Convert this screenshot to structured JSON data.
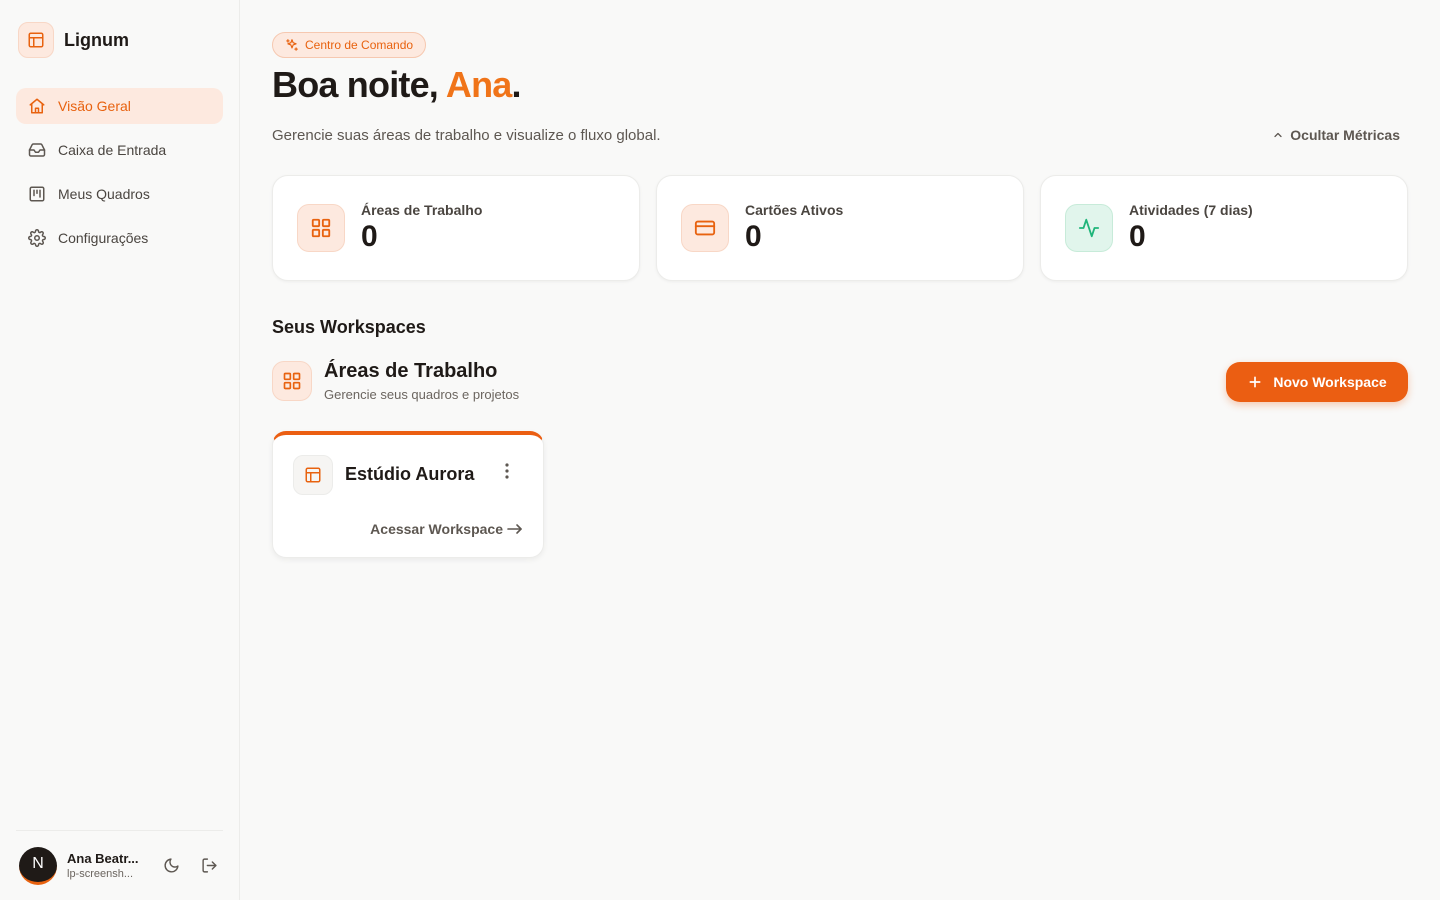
{
  "app": {
    "name": "Lignum"
  },
  "sidebar": {
    "items": [
      {
        "label": "Visão Geral",
        "icon": "home-icon",
        "active": true
      },
      {
        "label": "Caixa de Entrada",
        "icon": "inbox-icon",
        "active": false
      },
      {
        "label": "Meus Quadros",
        "icon": "kanban-icon",
        "active": false
      },
      {
        "label": "Configurações",
        "icon": "settings-icon",
        "active": false
      }
    ],
    "user": {
      "initial": "N",
      "name": "Ana Beatr...",
      "email": "lp-screensh..."
    }
  },
  "header": {
    "badge": "Centro de Comando",
    "greeting_prefix": "Boa noite, ",
    "greeting_name": "Ana",
    "greeting_suffix": ".",
    "subtitle": "Gerencie suas áreas de trabalho e visualize o fluxo global.",
    "hide_metrics_label": "Ocultar Métricas"
  },
  "metrics": [
    {
      "label": "Áreas de Trabalho",
      "value": "0",
      "icon": "grid-icon"
    },
    {
      "label": "Cartões Ativos",
      "value": "0",
      "icon": "card-icon"
    },
    {
      "label": "Atividades (7 dias)",
      "value": "0",
      "icon": "activity-icon"
    }
  ],
  "workspaces": {
    "section_title": "Seus Workspaces",
    "group_title": "Áreas de Trabalho",
    "group_subtitle": "Gerencie seus quadros e projetos",
    "new_button": "Novo Workspace",
    "cards": [
      {
        "name": "Estúdio Aurora",
        "link": "Acessar Workspace"
      }
    ]
  },
  "colors": {
    "accent": "#eb5e12",
    "accent_soft": "#fde9df",
    "success": "#1fb57a"
  }
}
